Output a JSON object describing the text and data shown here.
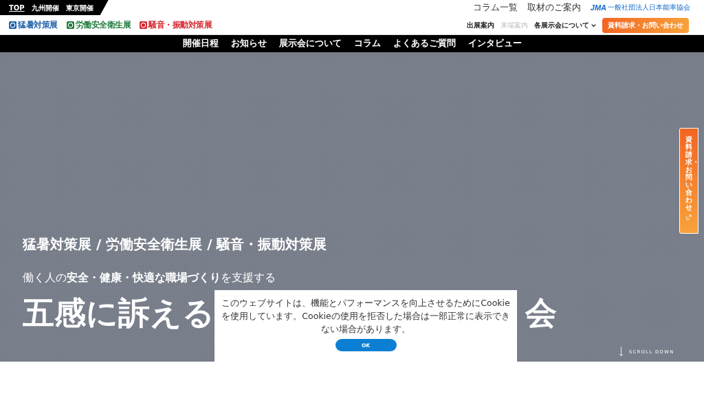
{
  "top_bar": {
    "links": [
      {
        "label": "TOP",
        "selected": true
      },
      {
        "label": "九州開催",
        "selected": false
      },
      {
        "label": "東京開催",
        "selected": false
      }
    ]
  },
  "header_links": [
    {
      "label": "コラム一覧"
    },
    {
      "label": "取材のご案内"
    }
  ],
  "organization": {
    "logo": "JMA",
    "name": "一般社団法人日本能率協会"
  },
  "brand_logos": [
    {
      "label": "猛暑対策展",
      "color": "#1e5fa8"
    },
    {
      "label": "労働安全衛生展",
      "color": "#1d7a3a"
    },
    {
      "label": "騒音・振動対策展",
      "color": "#d4232b"
    }
  ],
  "header_nav": [
    {
      "label": "出展案内",
      "disabled": false
    },
    {
      "label": "来場案内",
      "disabled": true
    },
    {
      "label": "各展示会について",
      "disabled": false
    }
  ],
  "cta_button": "資料請求・お問い合わせ",
  "main_nav": [
    "開催日程",
    "お知らせ",
    "展示会について",
    "コラム",
    "よくあるご質問",
    "インタビュー"
  ],
  "hero": {
    "title": "猛暑対策展 / 労働安全衛生展 / 騒音・振動対策展",
    "tagline": "働く人の**安全・健康・快適な職場づくり**を支援する",
    "headline_parts": [
      "五感に訴える",
      "会"
    ],
    "scroll_label": "SCROLL DOWN"
  },
  "side_tab": "資料請求・お問い合わせ",
  "cookie_banner": {
    "message": "このウェブサイトは、機能とパフォーマンスを向上させるためにCookieを使用しています。Cookieの使用を拒否した場合は一部正常に表示できない場合があります。",
    "button": "OK"
  }
}
